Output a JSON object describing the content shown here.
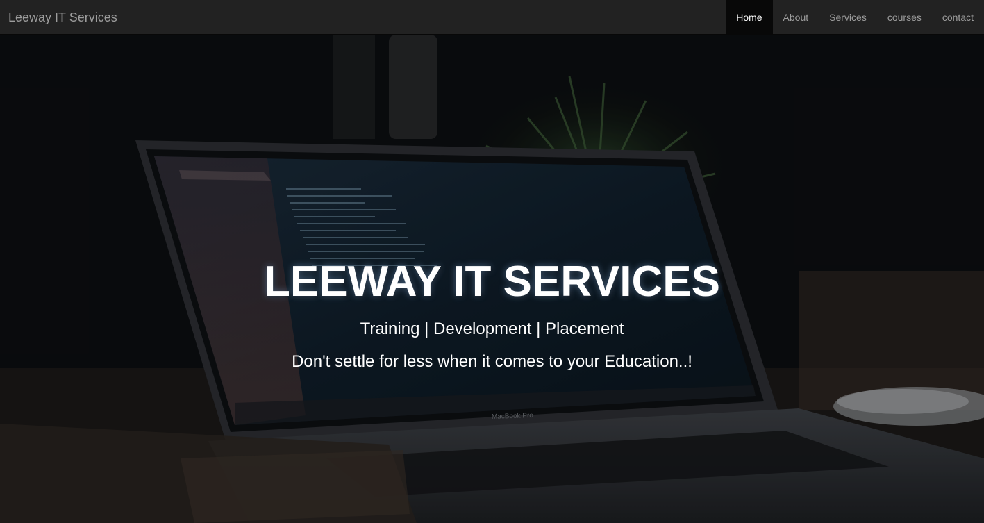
{
  "navbar": {
    "brand": "Leeway IT Services",
    "items": [
      {
        "label": "Home",
        "active": true
      },
      {
        "label": "About",
        "active": false
      },
      {
        "label": "Services",
        "active": false
      },
      {
        "label": "courses",
        "active": false
      },
      {
        "label": "contact",
        "active": false
      }
    ]
  },
  "hero": {
    "title": "LEEWAY IT SERVICES",
    "subtitle": "Training | Development | Placement",
    "tagline": "Don't settle for less when it comes to your Education..!",
    "background": "laptop-on-desk-photo",
    "laptop_label": "MacBook Pro"
  },
  "colors": {
    "navbar_bg": "#222222",
    "nav_active_bg": "#080808",
    "nav_text": "#9d9d9d",
    "hero_text": "#ffffff"
  }
}
